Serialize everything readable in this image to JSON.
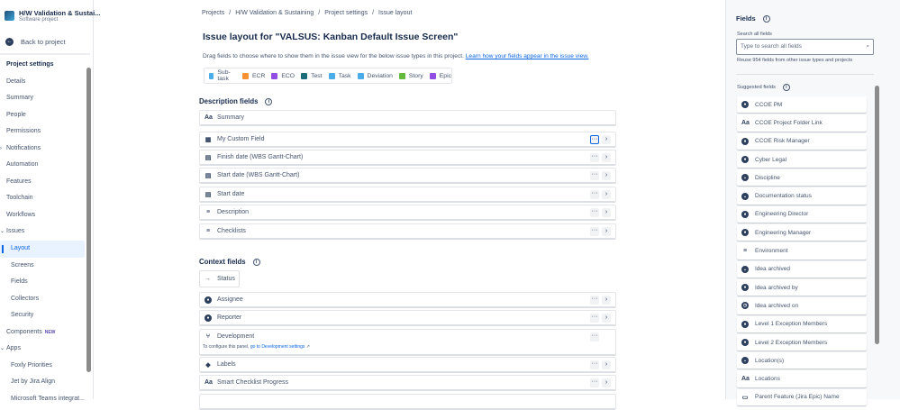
{
  "sidebar": {
    "project_name": "H/W Validation & Sustai...",
    "project_type": "Software project",
    "back": "Back to project",
    "items": [
      {
        "label": "Project settings",
        "type": "h"
      },
      {
        "label": "Details"
      },
      {
        "label": "Summary"
      },
      {
        "label": "People"
      },
      {
        "label": "Permissions"
      },
      {
        "label": "Notifications",
        "chev": "›"
      },
      {
        "label": "Automation"
      },
      {
        "label": "Features"
      },
      {
        "label": "Toolchain"
      },
      {
        "label": "Workflows"
      },
      {
        "label": "Issues",
        "chev": "⌄"
      },
      {
        "label": "Layout",
        "type": "sub act"
      },
      {
        "label": "Screens",
        "type": "sub"
      },
      {
        "label": "Fields",
        "type": "sub"
      },
      {
        "label": "Collectors",
        "type": "sub"
      },
      {
        "label": "Security",
        "type": "sub"
      },
      {
        "label": "Components",
        "badge": "NEW"
      },
      {
        "label": "Apps",
        "chev": "⌄"
      },
      {
        "label": "Foxly Priorities",
        "type": "sub"
      },
      {
        "label": "Jet by Jira Align",
        "type": "sub"
      },
      {
        "label": "Microsoft Teams integrat...",
        "type": "sub"
      }
    ]
  },
  "breadcrumb": [
    "Projects",
    "/",
    "H/W Validation & Sustaining",
    "/",
    "Project settings",
    "/",
    "Issue layout"
  ],
  "title": "Issue layout for \"VALSUS: Kanban Default Issue Screen\"",
  "description": "Drag fields to choose where to show them in the issue view for the below issue types in this project.",
  "learn_link": "Learn how your fields appear in the issue view.",
  "issue_types": [
    {
      "label": "Sub-task",
      "color": "#4bade8"
    },
    {
      "label": "ECR",
      "color": "#f79232"
    },
    {
      "label": "ECO",
      "color": "#904ee2"
    },
    {
      "label": "Test",
      "color": "#1d6a7a"
    },
    {
      "label": "Task",
      "color": "#4bade8"
    },
    {
      "label": "Deviation",
      "color": "#4bade8"
    },
    {
      "label": "Story",
      "color": "#63ba3c"
    },
    {
      "label": "Epic",
      "color": "#904ee2"
    }
  ],
  "description_fields": {
    "heading": "Description fields",
    "summary": "Summary",
    "rows": [
      {
        "label": "My Custom Field",
        "icon": "▦"
      },
      {
        "label": "Finish date (WBS Gantt-Chart)",
        "icon": "▤"
      },
      {
        "label": "Start date (WBS Gantt-Chart)",
        "icon": "▤"
      },
      {
        "label": "Start date",
        "icon": "▤"
      },
      {
        "label": "Description",
        "icon": "≡"
      },
      {
        "label": "Checklists",
        "icon": "≡"
      }
    ]
  },
  "context_fields": {
    "heading": "Context fields",
    "status": "Status",
    "assignee": "Assignee",
    "reporter": "Reporter",
    "development": "Development",
    "dev_note": "To configure this panel,",
    "dev_link": "go to Development settings",
    "labels": "Labels",
    "smart": "Smart Checklist Progress"
  },
  "fields_panel": {
    "heading": "Fields",
    "search_label": "Search all fields",
    "search_placeholder": "Type to search all fields",
    "reuse": "Reuse 954 fields from other issue types and projects",
    "suggested": "Suggested fields",
    "items": [
      {
        "label": "CCOE PM",
        "icon": "user"
      },
      {
        "label": "CCOE Project Folder Link",
        "icon": "text"
      },
      {
        "label": "CCOE Risk Manager",
        "icon": "user"
      },
      {
        "label": "Cyber Legal",
        "icon": "user"
      },
      {
        "label": "Discipline",
        "icon": "select"
      },
      {
        "label": "Documentation status",
        "icon": "select"
      },
      {
        "label": "Engineering Director",
        "icon": "user"
      },
      {
        "label": "Engineering Manager",
        "icon": "user"
      },
      {
        "label": "Environment",
        "icon": "para"
      },
      {
        "label": "Idea archived",
        "icon": "select"
      },
      {
        "label": "Idea archived by",
        "icon": "user"
      },
      {
        "label": "Idea archived on",
        "icon": "clock"
      },
      {
        "label": "Level 1 Exception Members",
        "icon": "user"
      },
      {
        "label": "Level 2 Exception Members",
        "icon": "user"
      },
      {
        "label": "Location(s)",
        "icon": "select"
      },
      {
        "label": "Locations",
        "icon": "text"
      },
      {
        "label": "Parent Feature (Jira Epic) Name",
        "icon": "folder"
      }
    ]
  }
}
